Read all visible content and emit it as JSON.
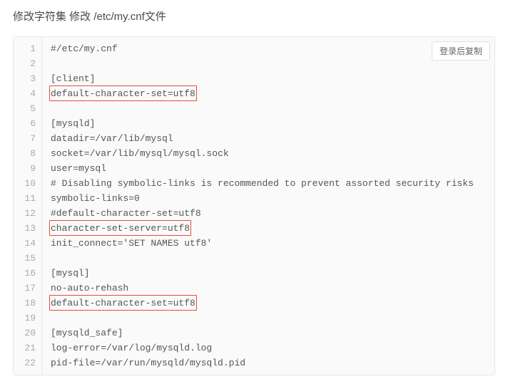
{
  "title": "修改字符集 修改 /etc/my.cnf文件",
  "copy_label": "登录后复制",
  "lines": [
    "#/etc/my.cnf",
    "",
    "[client]",
    "default-character-set=utf8",
    "",
    "[mysqld]",
    "datadir=/var/lib/mysql",
    "socket=/var/lib/mysql/mysql.sock",
    "user=mysql",
    "# Disabling symbolic-links is recommended to prevent assorted security risks",
    "symbolic-links=0",
    "#default-character-set=utf8",
    "character-set-server=utf8",
    "init_connect='SET NAMES utf8'",
    "",
    "[mysql]",
    "no-auto-rehash",
    "default-character-set=utf8",
    "",
    "[mysqld_safe]",
    "log-error=/var/log/mysqld.log",
    "pid-file=/var/run/mysqld/mysqld.pid"
  ],
  "highlights": [
    {
      "line": 4,
      "width_chars": 26
    },
    {
      "line": 13,
      "width_chars": 25
    },
    {
      "line": 18,
      "width_chars": 26
    }
  ]
}
